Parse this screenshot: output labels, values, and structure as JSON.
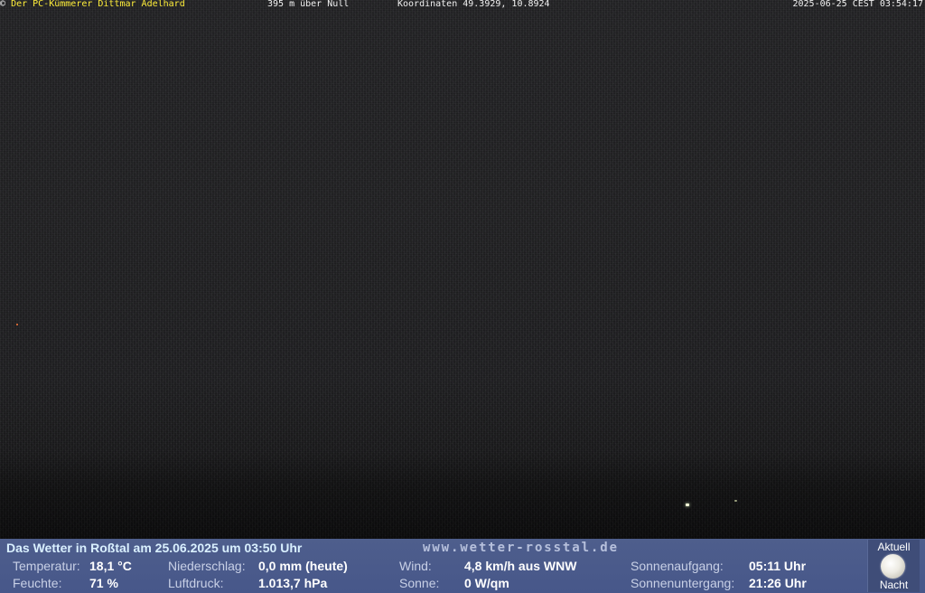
{
  "header": {
    "copyright": "©",
    "name": "Der PC-Kümmerer Dittmar Adelhard",
    "altitude": "395 m über Null",
    "coordinates": "Koordinaten 49.3929, 10.8924",
    "datetime": "2025-06-25 CEST 03:54:17"
  },
  "weather": {
    "title": "Das Wetter in Roßtal am 25.06.2025 um 03:50 Uhr",
    "website": "www.wetter-rosstal.de",
    "temperature": {
      "label": "Temperatur:",
      "value": "18,1 °C"
    },
    "humidity": {
      "label": "Feuchte:",
      "value": "71 %"
    },
    "precipitation": {
      "label": "Niederschlag:",
      "value": "0,0 mm (heute)"
    },
    "pressure": {
      "label": "Luftdruck:",
      "value": "1.013,7 hPa"
    },
    "wind": {
      "label": "Wind:",
      "value": "4,8 km/h aus WNW"
    },
    "sun": {
      "label": "Sonne:",
      "value": "0 W/qm"
    },
    "sunrise": {
      "label": "Sonnenaufgang:",
      "value": "05:11 Uhr"
    },
    "sunset": {
      "label": "Sonnenuntergang:",
      "value": "21:26 Uhr"
    },
    "moon": {
      "top_label": "Aktuell",
      "bottom_label": "Nacht",
      "icon": "moon-icon"
    }
  },
  "colors": {
    "panel_background": "#4a5a86",
    "title_text": "#d9f0ff",
    "name_text": "#ffee3a"
  }
}
